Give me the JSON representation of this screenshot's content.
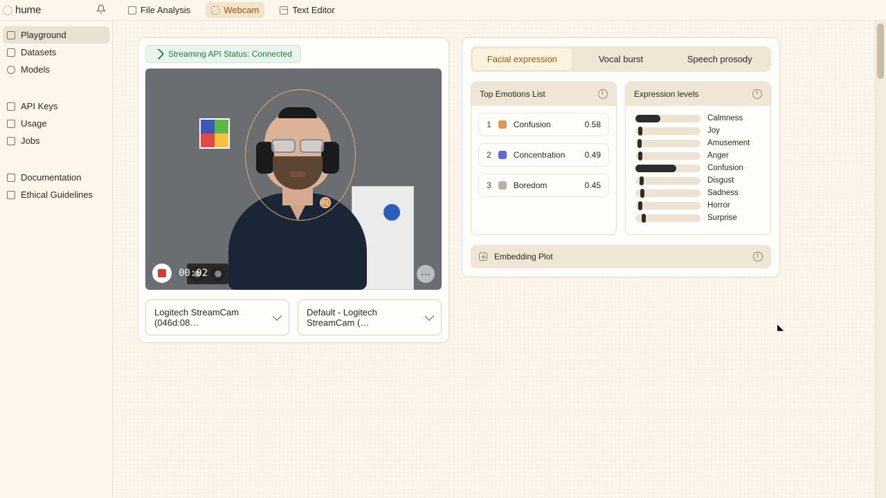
{
  "brand": "hume",
  "top_tabs": [
    {
      "label": "File Analysis",
      "active": false
    },
    {
      "label": "Webcam",
      "active": true
    },
    {
      "label": "Text Editor",
      "active": false
    }
  ],
  "sidebar": {
    "main": [
      {
        "label": "Playground",
        "active": true
      },
      {
        "label": "Datasets"
      },
      {
        "label": "Models"
      }
    ],
    "secondary": [
      {
        "label": "API Keys"
      },
      {
        "label": "Usage"
      },
      {
        "label": "Jobs"
      }
    ],
    "tertiary": [
      {
        "label": "Documentation"
      },
      {
        "label": "Ethical Guidelines"
      }
    ]
  },
  "stream_status": "Streaming API Status: Connected",
  "recording": {
    "time": "00:02",
    "pin": "P1"
  },
  "selects": {
    "camera": "Logitech StreamCam (046d:08…",
    "mic": "Default - Logitech StreamCam (…"
  },
  "result_tabs": [
    {
      "label": "Facial expression",
      "active": true
    },
    {
      "label": "Vocal burst"
    },
    {
      "label": "Speech prosody"
    }
  ],
  "top_emotions_title": "Top Emotions List",
  "top_emotions": [
    {
      "rank": "1",
      "name": "Confusion",
      "value": "0.58",
      "color": "#d99a59"
    },
    {
      "rank": "2",
      "name": "Concentration",
      "value": "0.49",
      "color": "#5a6bd8"
    },
    {
      "rank": "3",
      "name": "Boredom",
      "value": "0.45",
      "color": "#b9b0a0"
    }
  ],
  "levels_title": "Expression levels",
  "levels": [
    {
      "name": "Calmness",
      "fill_pct": 38,
      "cap_pct": 0
    },
    {
      "name": "Joy",
      "fill_pct": 0,
      "cap_pct": 4
    },
    {
      "name": "Amusement",
      "fill_pct": 0,
      "cap_pct": 3
    },
    {
      "name": "Anger",
      "fill_pct": 0,
      "cap_pct": 4
    },
    {
      "name": "Confusion",
      "fill_pct": 63,
      "cap_pct": 0
    },
    {
      "name": "Disgust",
      "fill_pct": 0,
      "cap_pct": 6
    },
    {
      "name": "Sadness",
      "fill_pct": 0,
      "cap_pct": 7
    },
    {
      "name": "Horror",
      "fill_pct": 0,
      "cap_pct": 4
    },
    {
      "name": "Surprise",
      "fill_pct": 0,
      "cap_pct": 10
    }
  ],
  "embedding_label": "Embedding Plot"
}
